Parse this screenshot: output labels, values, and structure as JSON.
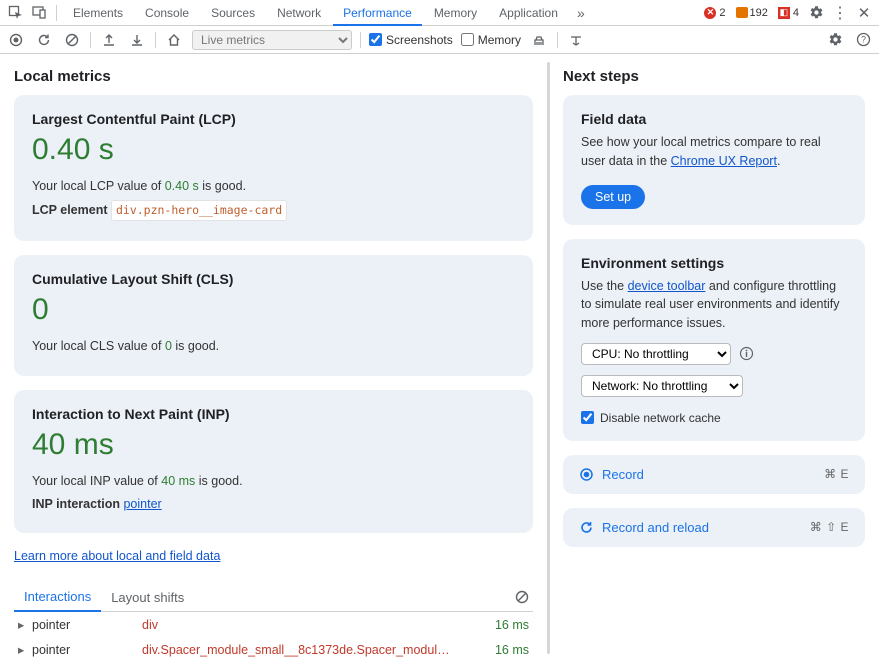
{
  "tabs": {
    "elements": "Elements",
    "console": "Console",
    "sources": "Sources",
    "network": "Network",
    "performance": "Performance",
    "memory": "Memory",
    "application": "Application"
  },
  "top_badges": {
    "errors": "2",
    "warnings": "192",
    "issues": "4"
  },
  "toolbar": {
    "live_metrics": "Live metrics",
    "screenshots": "Screenshots",
    "memory": "Memory"
  },
  "left": {
    "title": "Local metrics",
    "lcp": {
      "heading": "Largest Contentful Paint (LCP)",
      "value": "0.40 s",
      "line1_pre": "Your local LCP value of ",
      "line1_val": "0.40 s",
      "line1_post": " is good.",
      "line2_pre": "LCP element ",
      "line2_chip": "div.pzn-hero__image-card"
    },
    "cls": {
      "heading": "Cumulative Layout Shift (CLS)",
      "value": "0",
      "line1_pre": "Your local CLS value of ",
      "line1_val": "0",
      "line1_post": " is good."
    },
    "inp": {
      "heading": "Interaction to Next Paint (INP)",
      "value": "40 ms",
      "line1_pre": "Your local INP value of ",
      "line1_val": "40 ms",
      "line1_post": " is good.",
      "line2_pre": "INP interaction ",
      "line2_link": "pointer"
    },
    "learn_link": "Learn more about local and field data",
    "subtabs": {
      "interactions": "Interactions",
      "layout_shifts": "Layout shifts"
    },
    "rows": [
      {
        "type": "pointer",
        "target": "div",
        "time": "16 ms"
      },
      {
        "type": "pointer",
        "target": "div.Spacer_module_small__8c1373de.Spacer_modul…",
        "time": "16 ms"
      }
    ]
  },
  "right": {
    "title": "Next steps",
    "field": {
      "heading": "Field data",
      "text_pre": "See how your local metrics compare to real user data in the ",
      "link": "Chrome UX Report",
      "text_post": ".",
      "button": "Set up"
    },
    "env": {
      "heading": "Environment settings",
      "text_pre": "Use the ",
      "link": "device toolbar",
      "text_post": " and configure throttling to simulate real user environments and identify more performance issues.",
      "cpu": "CPU: No throttling",
      "net": "Network: No throttling",
      "disable_cache": "Disable network cache"
    },
    "record": {
      "label": "Record",
      "shortcut": "⌘ E"
    },
    "reload": {
      "label": "Record and reload",
      "shortcut": "⌘ ⇧ E"
    }
  }
}
